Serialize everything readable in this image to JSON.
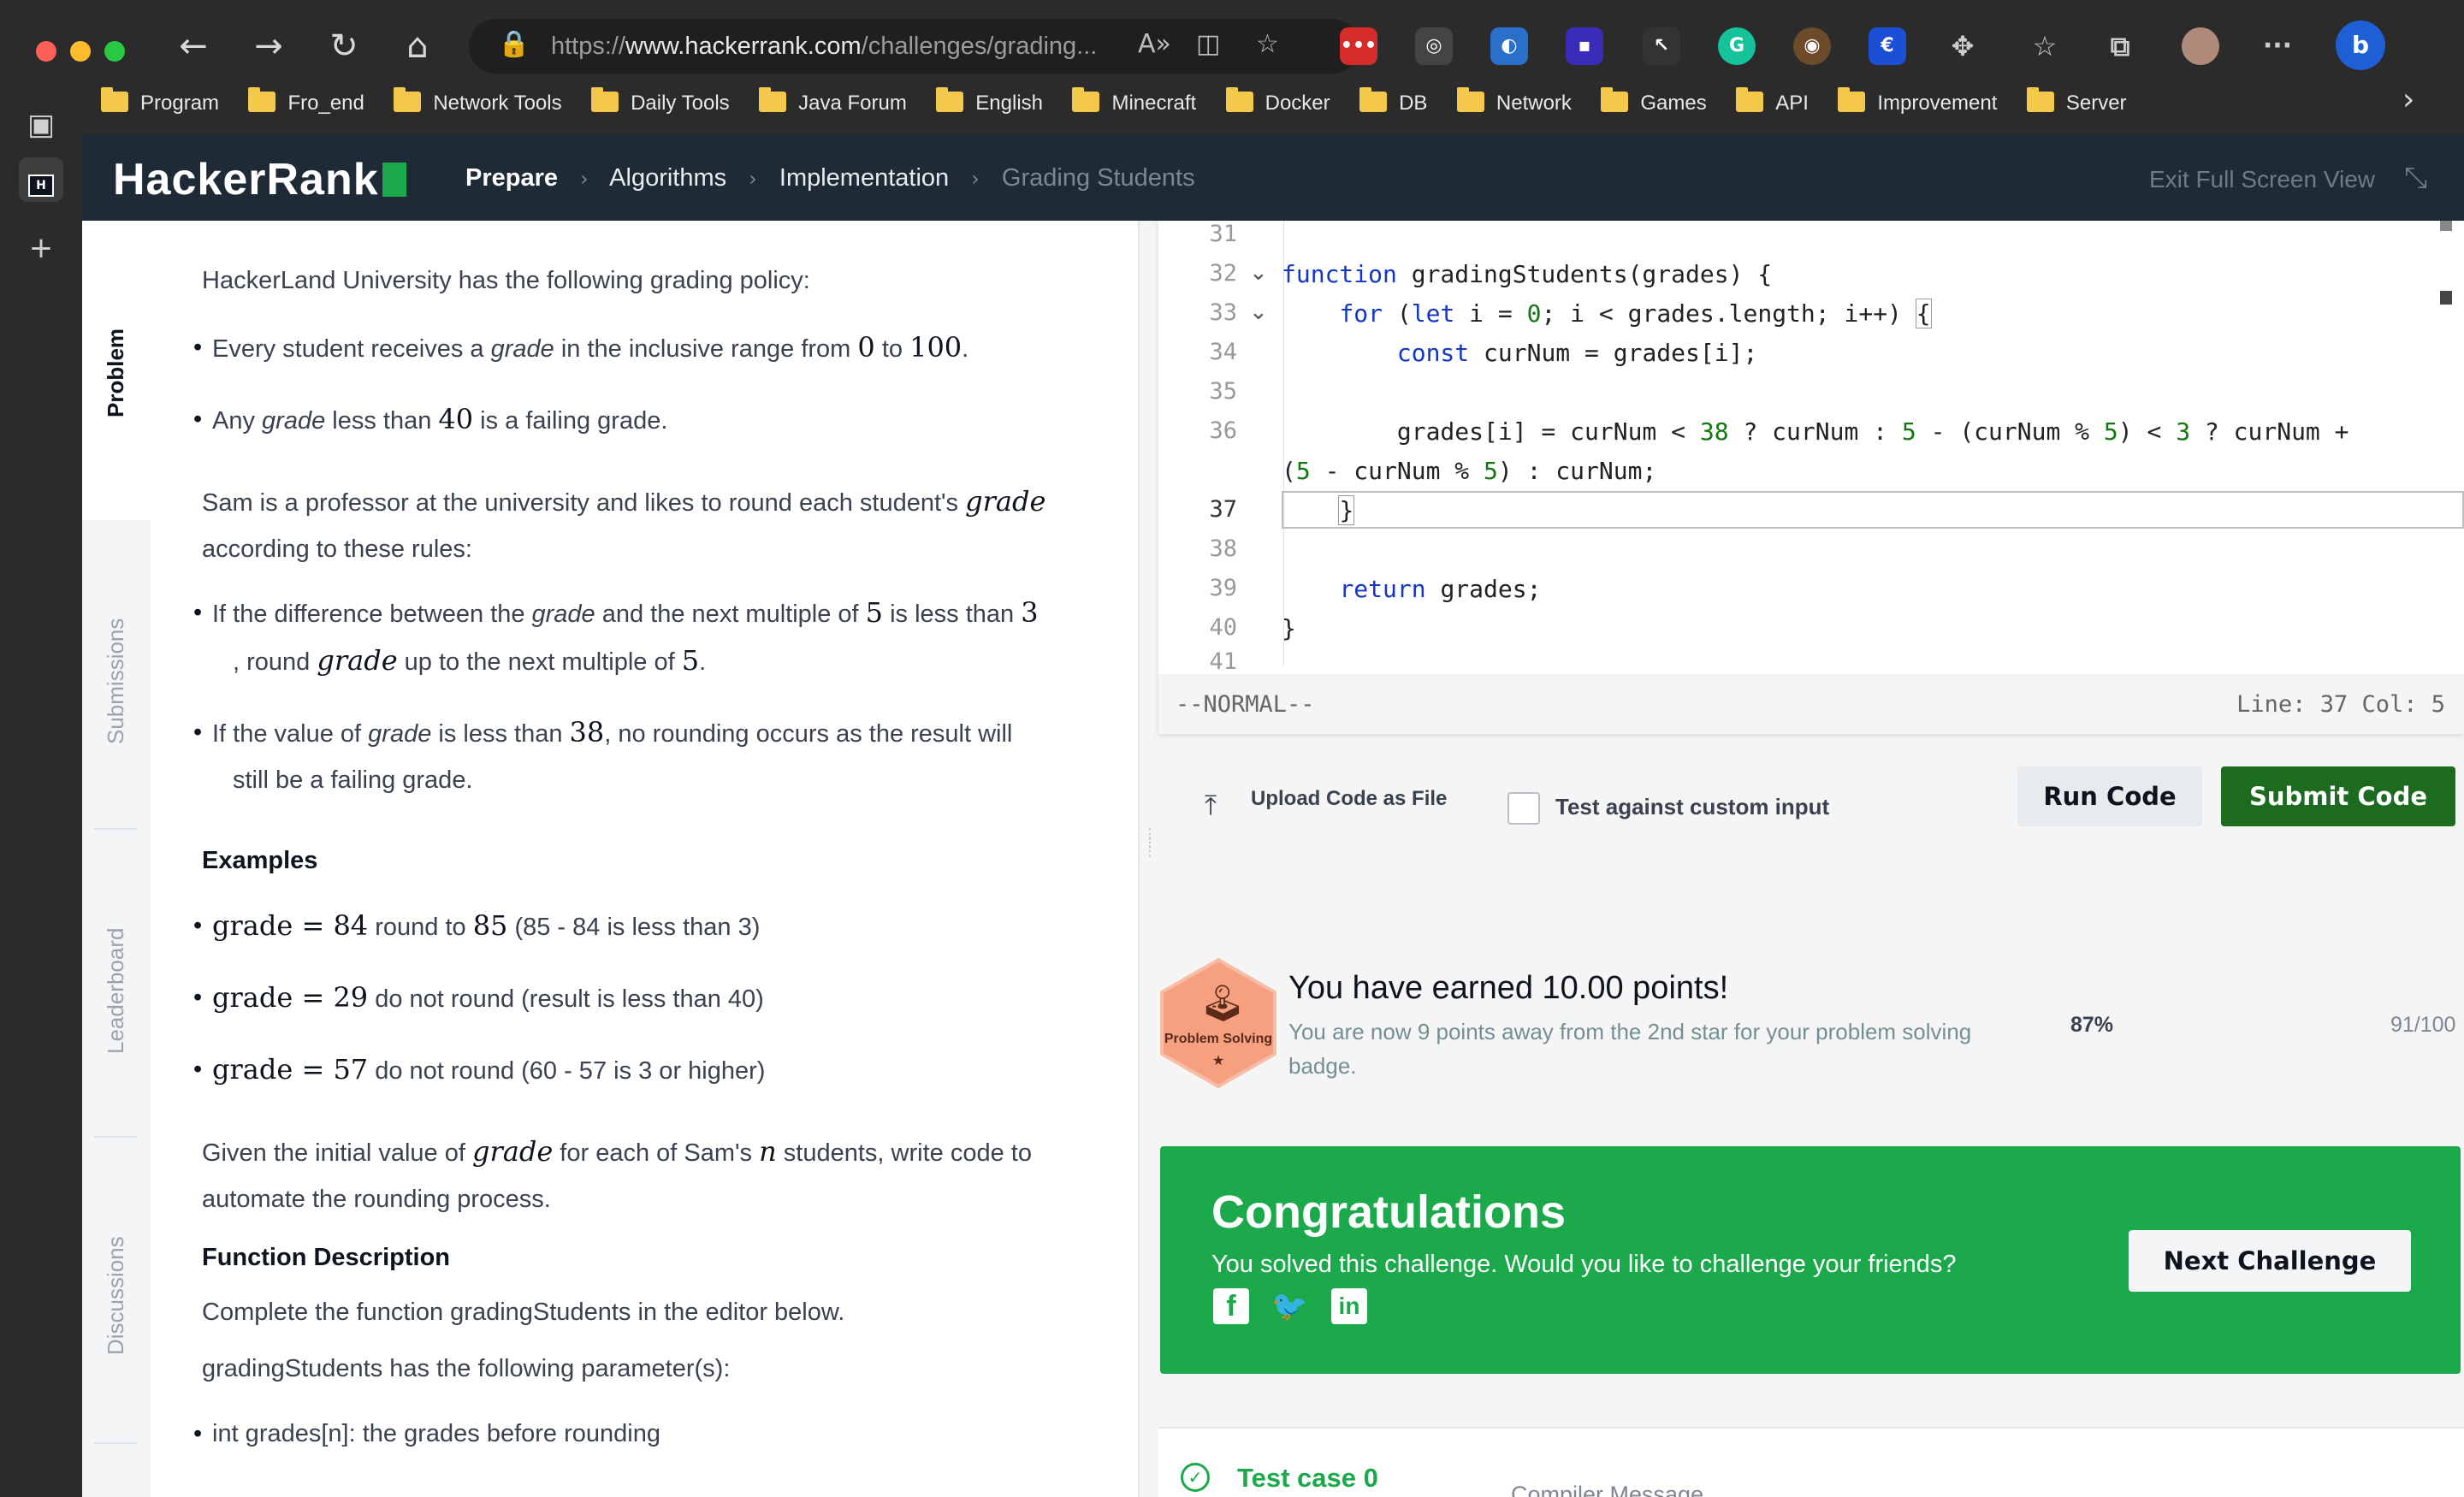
{
  "browser": {
    "url_prefix": "https://",
    "url_host": "www.hackerrank.com",
    "url_path": "/challenges/grading...",
    "bookmarks": [
      "Program",
      "Fro_end",
      "Network Tools",
      "Daily Tools",
      "Java Forum",
      "English",
      "Minecraft",
      "Docker",
      "DB",
      "Network",
      "Games",
      "API",
      "Improvement",
      "Server"
    ]
  },
  "header": {
    "logo": "HackerRank",
    "breadcrumb": [
      "Prepare",
      "Algorithms",
      "Implementation",
      "Grading Students"
    ],
    "exit_fullscreen": "Exit Full Screen View"
  },
  "sidetabs": {
    "problem": "Problem",
    "submissions": "Submissions",
    "leaderboard": "Leaderboard",
    "discussions": "Discussions"
  },
  "problem": {
    "intro": "HackerLand University has the following grading policy:",
    "policy_1_a": "Every student receives a ",
    "policy_1_var": "grade",
    "policy_1_b": " in the inclusive range from ",
    "policy_1_min": "0",
    "policy_1_c": " to ",
    "policy_1_max": "100",
    "policy_1_d": ".",
    "policy_2_a": "Any ",
    "policy_2_var": "grade",
    "policy_2_b": " less than ",
    "policy_2_num": "40",
    "policy_2_c": " is a failing grade.",
    "sam_a": "Sam is a professor at the university and likes to round each student's ",
    "sam_var": "grade",
    "sam_b": "according to these rules:",
    "rule_1_a": "If the difference between the ",
    "rule_1_var": "grade",
    "rule_1_b": " and the next multiple of ",
    "rule_1_n1": "5",
    "rule_1_c": " is less than ",
    "rule_1_n2": "3",
    "rule_1_d": ", round ",
    "rule_1_var2": "grade",
    "rule_1_e": " up to the next multiple of ",
    "rule_1_n3": "5",
    "rule_1_f": ".",
    "rule_2_a": "If the value of ",
    "rule_2_var": "grade",
    "rule_2_b": " is less than ",
    "rule_2_num": "38",
    "rule_2_c": ", no rounding occurs as the result will",
    "rule_2_d": "still be a failing grade.",
    "examples_heading": "Examples",
    "examples": [
      {
        "math": "grade = 84",
        "text": " round to ",
        "math2": "85",
        "text2": " (85 - 84 is less than 3)"
      },
      {
        "math": "grade = 29",
        "text": " do not round (result is less than 40)",
        "math2": "",
        "text2": ""
      },
      {
        "math": "grade = 57",
        "text": " do not round (60 - 57 is 3 or higher)",
        "math2": "",
        "text2": ""
      }
    ],
    "given_a": "Given the initial value of ",
    "given_var": "grade",
    "given_b": " for each of Sam's ",
    "given_n": "n",
    "given_c": " students, write code to",
    "given_d": "automate the rounding process.",
    "func_heading": "Function Description",
    "func_desc": "Complete the function gradingStudents in the editor below.",
    "params_intro": "gradingStudents has the following parameter(s):",
    "param_1": "int grades[n]: the grades before rounding"
  },
  "editor": {
    "line_numbers": [
      "31",
      "32",
      "33",
      "34",
      "35",
      "36",
      "",
      "37",
      "38",
      "39",
      "40",
      "41"
    ],
    "mode": "--NORMAL--",
    "cursor": "Line: 37 Col: 5"
  },
  "actions": {
    "upload": "Upload Code as File",
    "custom_input": "Test against custom input",
    "run": "Run Code",
    "submit": "Submit Code"
  },
  "points": {
    "badge_label": "Problem Solving",
    "badge_star": "★",
    "title": "You have earned 10.00 points!",
    "subtitle": "You are now 9 points away from the 2nd star for your problem solving badge.",
    "percent": "87%",
    "progress": "91/100"
  },
  "congrats": {
    "title": "Congratulations",
    "subtitle": "You solved this challenge. Would you like to challenge your friends?",
    "next": "Next Challenge"
  },
  "testcase": {
    "label": "Test case 0",
    "compiler": "Compiler Message"
  },
  "colors": {
    "brand_green": "#1ba94c",
    "submit_green": "#1c6b1f",
    "header_bg": "#1f2a37"
  }
}
